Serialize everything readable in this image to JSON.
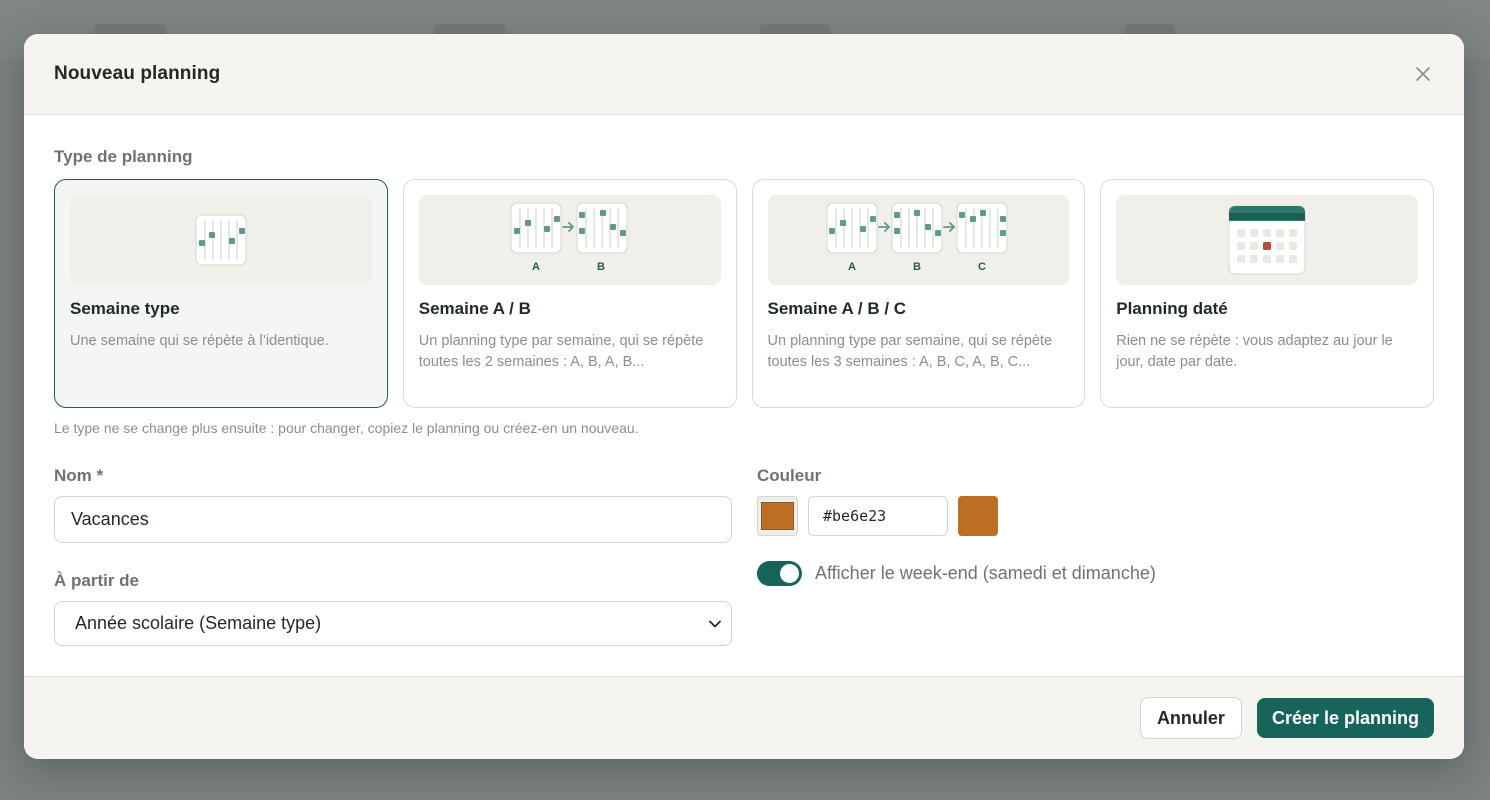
{
  "modal": {
    "title": "Nouveau planning"
  },
  "planning_type": {
    "label": "Type de planning",
    "cards": [
      {
        "title": "Semaine type",
        "desc": "Une semaine qui se répète à l’identique.",
        "selected": true
      },
      {
        "title": "Semaine A / B",
        "desc": "Un planning type par semaine, qui se répète toutes les 2 semaines : A, B, A, B...",
        "tags": [
          "A",
          "B"
        ]
      },
      {
        "title": "Semaine A / B / C",
        "desc": "Un planning type par semaine, qui se répète toutes les 3 semaines : A, B, C, A, B, C...",
        "tags": [
          "A",
          "B",
          "C"
        ]
      },
      {
        "title": "Planning daté",
        "desc": "Rien ne se répète : vous adaptez au jour le jour, date par date."
      }
    ],
    "hint": "Le type ne se change plus ensuite : pour changer, copiez le planning ou créez-en un nouveau."
  },
  "form": {
    "name_label": "Nom *",
    "name_value": "Vacances",
    "from_label": "À partir de",
    "from_value": "Année scolaire (Semaine type)",
    "color_label": "Couleur",
    "color_value": "#be6e23",
    "weekend_label": "Afficher le week-end (samedi et dimanche)",
    "weekend_on": true
  },
  "footer": {
    "cancel_label": "Annuler",
    "create_label": "Créer le planning"
  },
  "colors": {
    "accent": "#17655a",
    "chosen": "#be6e23",
    "illus_dot": "#5c9c90"
  }
}
